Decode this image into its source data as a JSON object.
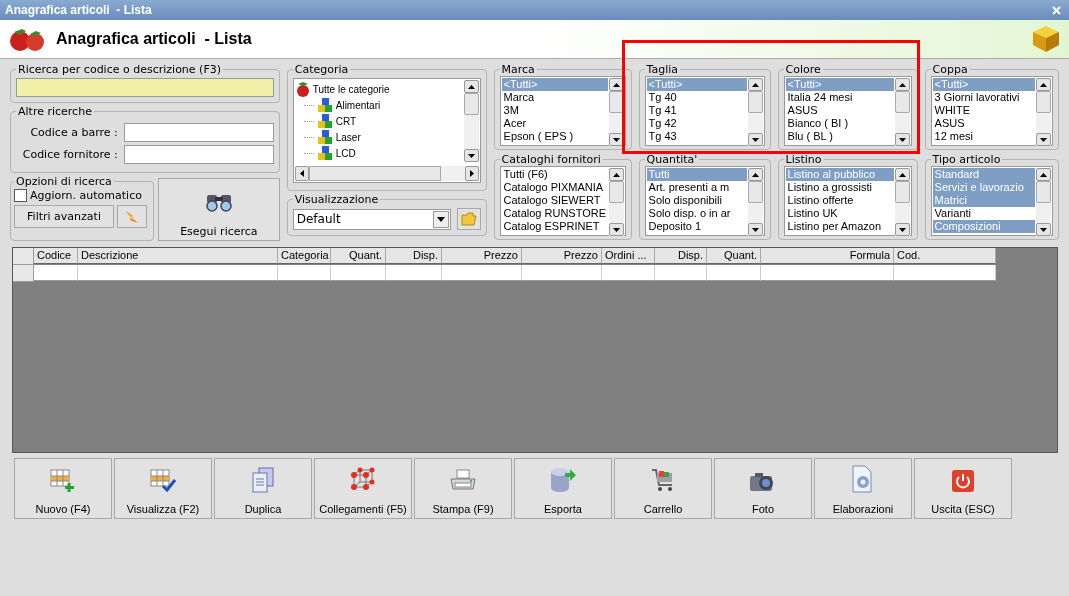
{
  "window": {
    "title": "Anagrafica articoli  - Lista"
  },
  "header": {
    "title": "Anagrafica articoli  - Lista"
  },
  "search": {
    "title": "Ricerca per codice o descrizione (F3)"
  },
  "other_search": {
    "title": "Altre ricerche",
    "fields": [
      {
        "label": "Codice a barre :"
      },
      {
        "label": "Codice fornitore :"
      }
    ]
  },
  "options": {
    "title": "Opzioni di ricerca",
    "auto_update": {
      "label": "Aggiorn. automatico",
      "checked": false
    },
    "advanced_button": "Filtri avanzati"
  },
  "run_button": "Esegui ricerca",
  "category": {
    "title": "Categoria",
    "root": {
      "label": "Tutte le categorie",
      "children": [
        {
          "label": "Alimentari"
        },
        {
          "label": "CRT"
        },
        {
          "label": "Laser"
        },
        {
          "label": "LCD"
        }
      ]
    }
  },
  "view": {
    "title": "Visualizzazione",
    "value": "Default"
  },
  "lists": [
    {
      "title": "Marca",
      "items": [
        {
          "label": "<Tutti>",
          "selected": true
        },
        {
          "label": "Marca",
          "selected": false
        },
        {
          "label": "3M",
          "selected": false
        },
        {
          "label": "Acer",
          "selected": false
        },
        {
          "label": "Epson ( EPS )",
          "selected": false
        }
      ]
    },
    {
      "title": "Taglia",
      "items": [
        {
          "label": "<Tutti>",
          "selected": true
        },
        {
          "label": "Tg 40",
          "selected": false
        },
        {
          "label": "Tg 41",
          "selected": false
        },
        {
          "label": "Tg 42",
          "selected": false
        },
        {
          "label": "Tg 43",
          "selected": false
        }
      ]
    },
    {
      "title": "Colore",
      "items": [
        {
          "label": "<Tutti>",
          "selected": true
        },
        {
          "label": "Italia 24 mesi",
          "selected": false
        },
        {
          "label": "ASUS",
          "selected": false
        },
        {
          "label": "Bianco ( BI )",
          "selected": false
        },
        {
          "label": "Blu ( BL )",
          "selected": false
        }
      ]
    },
    {
      "title": "Coppa",
      "items": [
        {
          "label": "<Tutti>",
          "selected": true
        },
        {
          "label": "3 Giorni lavorativi",
          "selected": false
        },
        {
          "label": "WHITE",
          "selected": false
        },
        {
          "label": "ASUS",
          "selected": false
        },
        {
          "label": "12 mesi",
          "selected": false
        }
      ]
    },
    {
      "title": "Cataloghi fornitori",
      "items": [
        {
          "label": "Tutti (F6)",
          "selected": false
        },
        {
          "label": "Catalogo PIXMANIA",
          "selected": false
        },
        {
          "label": "Catalogo SIEWERT",
          "selected": false
        },
        {
          "label": "Catalog RUNSTORE",
          "selected": false
        },
        {
          "label": "Catalog ESPRINET",
          "selected": false
        }
      ]
    },
    {
      "title": "Quantita'",
      "items": [
        {
          "label": "Tutti",
          "selected": true
        },
        {
          "label": "Art. presenti a m",
          "selected": false
        },
        {
          "label": "Solo disponibili",
          "selected": false
        },
        {
          "label": "Solo disp. o in ar",
          "selected": false
        },
        {
          "label": "Deposito 1",
          "selected": false
        }
      ]
    },
    {
      "title": "Listino",
      "items": [
        {
          "label": "Listino al pubblico",
          "selected": true
        },
        {
          "label": "Listino a grossisti",
          "selected": false
        },
        {
          "label": "Listino offerte",
          "selected": false
        },
        {
          "label": "Listino UK",
          "selected": false
        },
        {
          "label": "Listino per Amazon",
          "selected": false
        }
      ]
    },
    {
      "title": "Tipo articolo",
      "items": [
        {
          "label": "Standard",
          "selected": true
        },
        {
          "label": "Servizi e lavorazio",
          "selected": true
        },
        {
          "label": "Matrici",
          "selected": true
        },
        {
          "label": "Varianti",
          "selected": false
        },
        {
          "label": "Composizioni",
          "selected": true
        }
      ]
    }
  ],
  "table": {
    "columns": [
      {
        "label": "Codice"
      },
      {
        "label": "Descrizione"
      },
      {
        "label": "Categoria"
      },
      {
        "label": "Quant."
      },
      {
        "label": "Disp."
      },
      {
        "label": "Prezzo"
      },
      {
        "label": "Prezzo"
      },
      {
        "label": "Ordini ..."
      },
      {
        "label": "Disp."
      },
      {
        "label": "Quant."
      },
      {
        "label": "Formula"
      },
      {
        "label": "Cod."
      }
    ]
  },
  "buttons": [
    {
      "label": "Nuovo (F4)"
    },
    {
      "label": "Visualizza (F2)"
    },
    {
      "label": "Duplica"
    },
    {
      "label": "Collegamenti (F5)"
    },
    {
      "label": "Stampa (F9)"
    },
    {
      "label": "Esporta"
    },
    {
      "label": "Carrello"
    },
    {
      "label": "Foto"
    },
    {
      "label": "Elaborazioni"
    },
    {
      "label": "Uscita (ESC)"
    }
  ],
  "annotation": {
    "kind": "rectangle"
  }
}
